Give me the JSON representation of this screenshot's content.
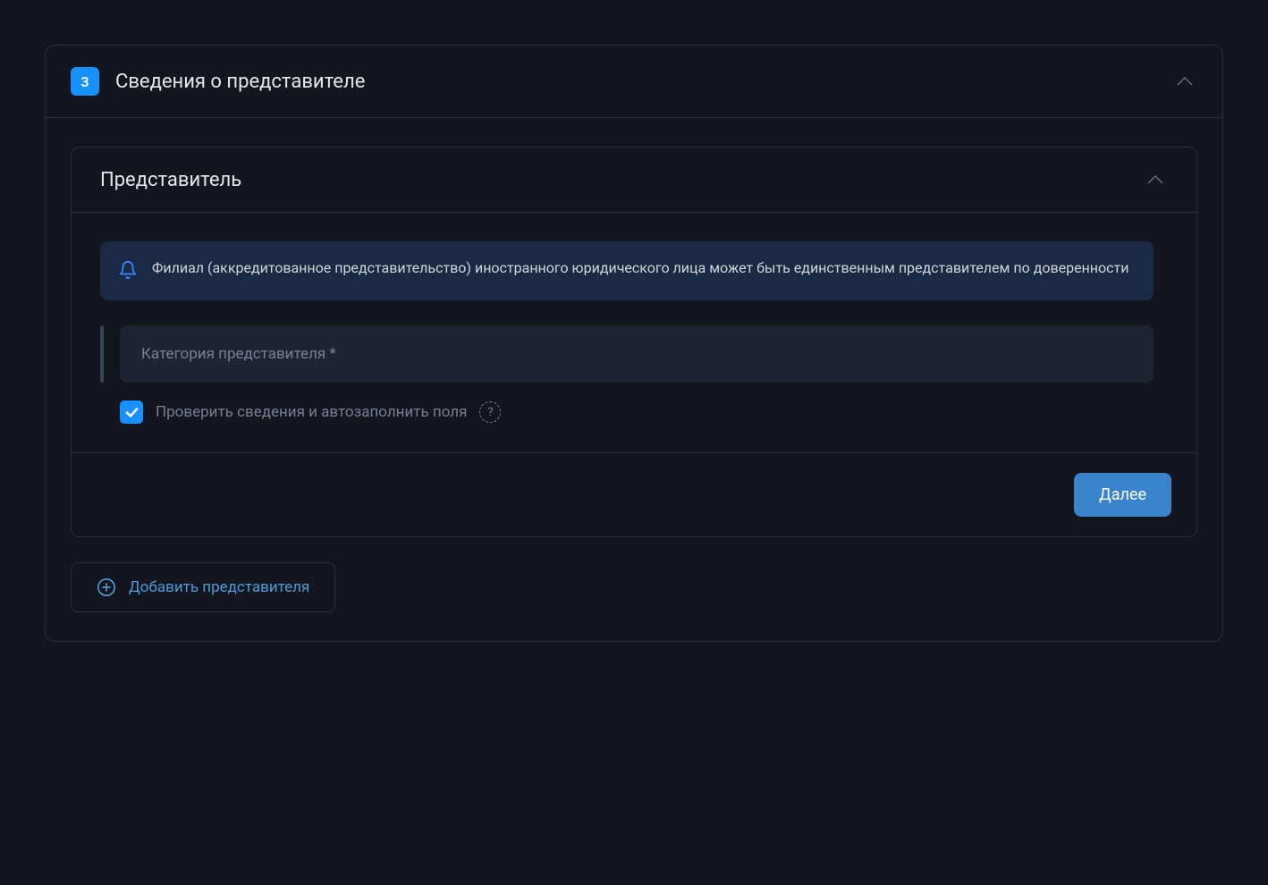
{
  "section": {
    "step_number": "3",
    "title": "Сведения о представителе"
  },
  "representative": {
    "header": "Представитель",
    "info_banner": "Филиал (аккредитованное представительство) иностранного юридического лица может быть единственным представителем по доверенности",
    "category_placeholder": "Категория представителя *",
    "checkbox_label": "Проверить сведения и автозаполнить поля",
    "help_icon": "?",
    "next_button": "Далее"
  },
  "add_button": "Добавить представителя"
}
